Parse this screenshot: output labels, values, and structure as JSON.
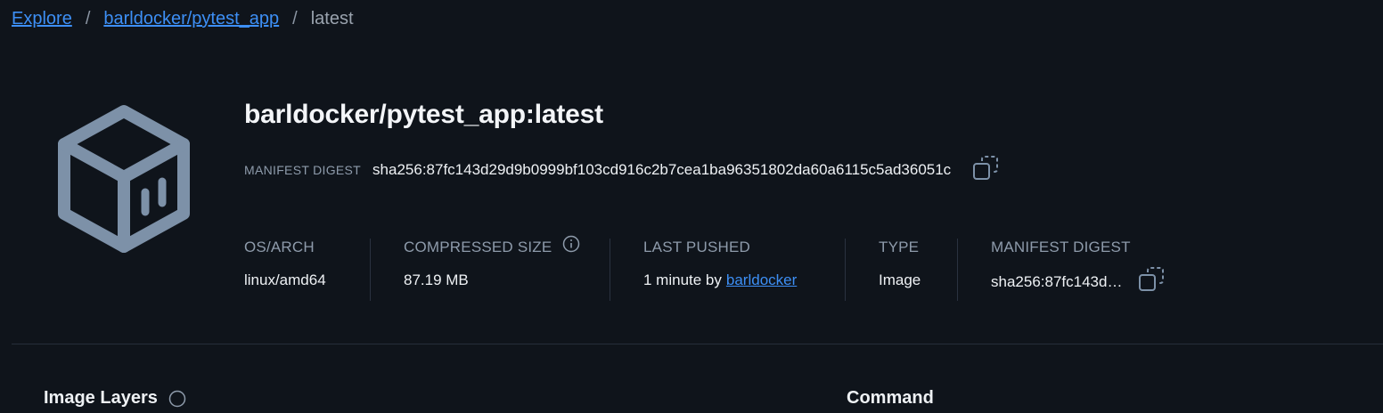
{
  "breadcrumb": {
    "items": [
      "Explore",
      "barldocker/pytest_app"
    ],
    "separator": "/",
    "current": "latest"
  },
  "image": {
    "title": "barldocker/pytest_app:latest",
    "digest_label": "MANIFEST DIGEST",
    "digest_value": "sha256:87fc143d29d9b0999bf103cd916c2b7cea1ba96351802da60a6115c5ad36051c",
    "logo_icon": "docker-image-box-icon",
    "copy_icon": "copy-icon"
  },
  "meta": {
    "os_arch": {
      "label": "OS/ARCH",
      "value": "linux/amd64"
    },
    "compressed_size": {
      "label": "COMPRESSED SIZE",
      "value": "87.19 MB",
      "icon": "info-icon"
    },
    "last_pushed": {
      "label": "LAST PUSHED",
      "value_prefix": "1 minute by",
      "user": "barldocker"
    },
    "type": {
      "label": "TYPE",
      "value": "Image"
    },
    "manifest_digest": {
      "label": "MANIFEST DIGEST",
      "value": "sha256:87fc143d…"
    }
  },
  "sections": {
    "layers_title": "Image Layers",
    "command_title": "Command"
  },
  "colors": {
    "background": "#0f141b",
    "link": "#3d8ff5",
    "muted": "#8e9bab",
    "logo": "#7d91a8"
  }
}
